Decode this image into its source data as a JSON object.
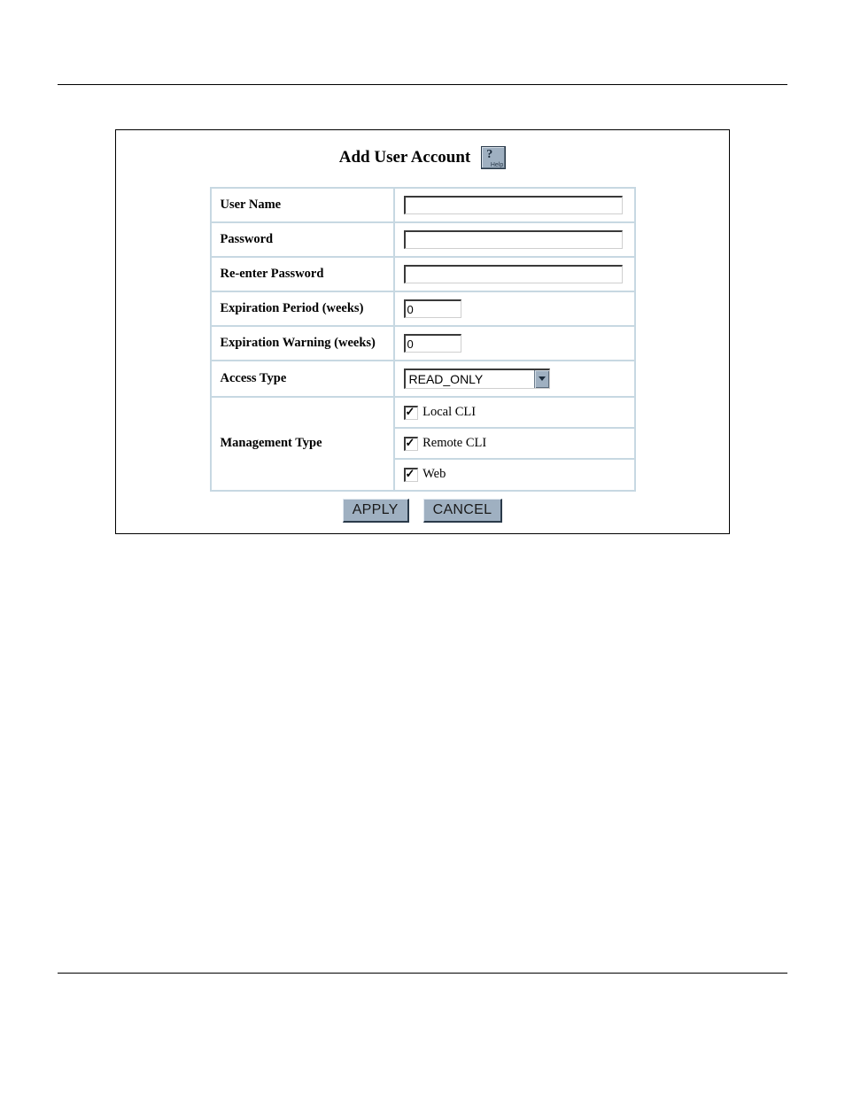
{
  "title": "Add User Account",
  "help_label": "Help",
  "fields": {
    "user_name": {
      "label": "User Name",
      "value": ""
    },
    "password": {
      "label": "Password",
      "value": ""
    },
    "reenter": {
      "label": "Re-enter Password",
      "value": ""
    },
    "exp_period": {
      "label": "Expiration Period (weeks)",
      "value": "0"
    },
    "exp_warning": {
      "label": "Expiration Warning (weeks)",
      "value": "0"
    },
    "access_type": {
      "label": "Access Type",
      "selected": "READ_ONLY"
    },
    "mgmt_type": {
      "label": "Management Type",
      "options": [
        {
          "label": "Local CLI",
          "checked": true
        },
        {
          "label": "Remote CLI",
          "checked": true
        },
        {
          "label": "Web",
          "checked": true
        }
      ]
    }
  },
  "buttons": {
    "apply": "APPLY",
    "cancel": "CANCEL"
  }
}
